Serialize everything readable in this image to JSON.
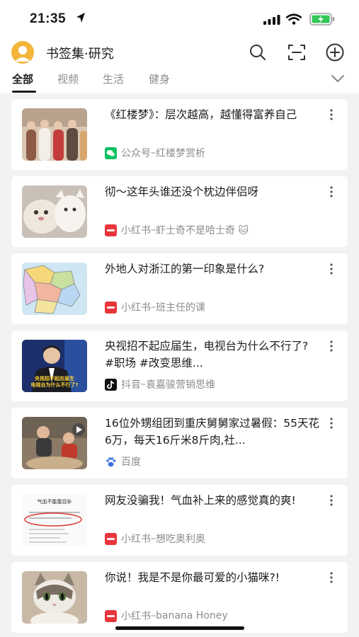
{
  "status": {
    "time": "21:35"
  },
  "header": {
    "title": "书签集·研究"
  },
  "tabs": [
    {
      "label": "全部",
      "active": true
    },
    {
      "label": "视频",
      "active": false
    },
    {
      "label": "生活",
      "active": false
    },
    {
      "label": "健身",
      "active": false
    }
  ],
  "items": [
    {
      "title": "《红楼梦》：层次越高，越懂得富养自己",
      "app": "公众号",
      "sep": " – ",
      "author": "红楼梦赏析",
      "source_icon": "wechat-icon"
    },
    {
      "title": "彻～这年头谁还没个枕边伴侣呀",
      "app": "小红书",
      "sep": " – ",
      "author": "虾士奇不是哈士奇 🐱",
      "source_icon": "xiaohongshu-icon"
    },
    {
      "title": "外地人对浙江的第一印象是什么?",
      "app": "小红书",
      "sep": " – ",
      "author": "班主任的课",
      "source_icon": "xiaohongshu-icon"
    },
    {
      "title": "央视招不起应届生，电视台为什么不行了? #职场 #改变思维...",
      "app": "抖音",
      "sep": " – ",
      "author": "袁嘉骏营销思维",
      "source_icon": "douyin-icon"
    },
    {
      "title": "16位外甥组团到重庆舅舅家过暑假：55天花6万，每天16斤米8斤肉,社...",
      "app": "百度",
      "sep": "",
      "author": "",
      "source_icon": "baidu-icon"
    },
    {
      "title": "网友没骗我！气血补上来的感觉真的爽!",
      "app": "小红书",
      "sep": " – ",
      "author": "想吃奥利奥",
      "source_icon": "xiaohongshu-icon"
    },
    {
      "title": "你说！我是不是你最可爱的小猫咪?!",
      "app": "小红书",
      "sep": " – ",
      "author": "banana Honey",
      "source_icon": "xiaohongshu-icon"
    }
  ],
  "thumb_texts": {
    "news_caption": "央视招不起应届生\n电视台为什么不行了?",
    "note_heading": "气血不能靠目补"
  },
  "colors": {
    "accent": "#f4b53b",
    "wechat": "#07c160",
    "xhs": "#e8353c",
    "battery": "#34c759"
  }
}
